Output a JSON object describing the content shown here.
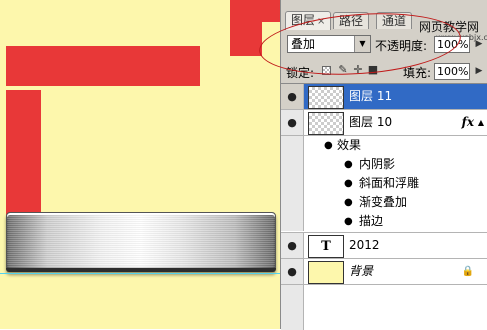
{
  "panel": {
    "tabs": [
      {
        "label": "图层",
        "active": true
      },
      {
        "label": "路径",
        "active": false
      },
      {
        "label": "通道",
        "active": false
      }
    ],
    "close_glyph": "×",
    "watermark": "网页教学网",
    "watermark_url": "www.webjx.com"
  },
  "blend_mode": {
    "value": "叠加"
  },
  "opacity": {
    "label": "不透明度:",
    "value": "100%"
  },
  "lock": {
    "label": "锁定:"
  },
  "fill": {
    "label": "填充:",
    "value": "100%"
  },
  "layers": [
    {
      "name": "图层 11",
      "selected": true,
      "thumb": "transparent"
    },
    {
      "name": "图层 10",
      "selected": false,
      "thumb": "transparent",
      "fx": "fx"
    },
    {
      "name": "2012",
      "selected": false,
      "thumb": "text",
      "thumb_text": "T"
    },
    {
      "name": "背景",
      "selected": false,
      "thumb": "fill",
      "italic": true
    }
  ],
  "effects": {
    "header": "效果",
    "items": [
      "内阴影",
      "斜面和浮雕",
      "渐变叠加",
      "描边"
    ]
  },
  "colors": {
    "canvas_bg": "#fdf7ac",
    "red": "#e83838",
    "selection": "#316ac5",
    "annotation": "#c01a1a"
  }
}
